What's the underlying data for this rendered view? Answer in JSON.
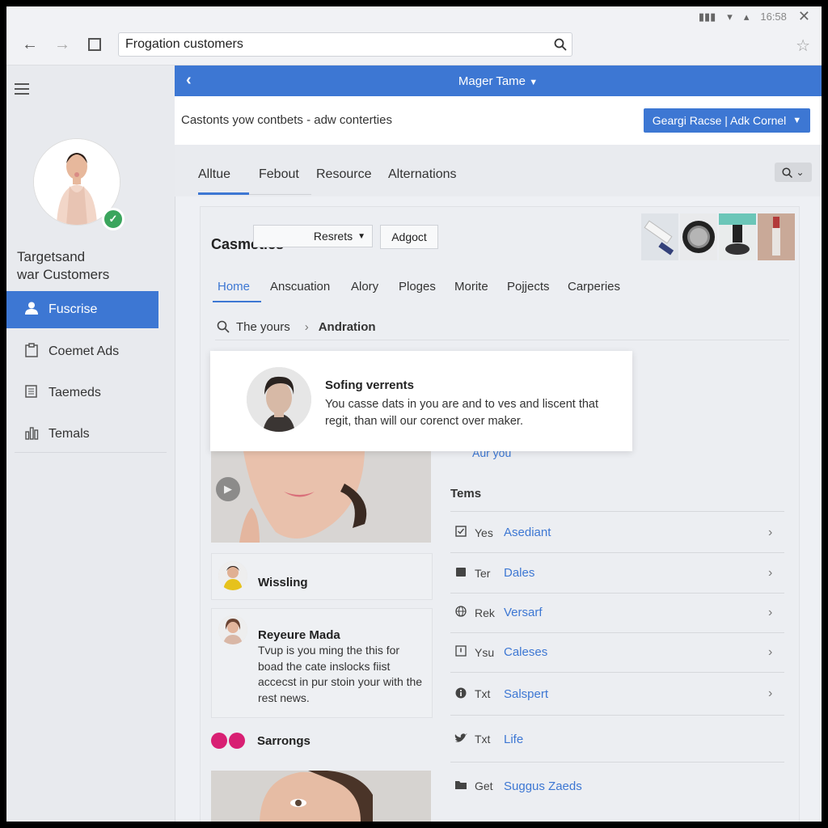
{
  "os": {
    "time": "16:58"
  },
  "browser": {
    "url_text": "Frogation customers"
  },
  "sidebar": {
    "profile_name_line1": "Targetsand",
    "profile_name_line2": "war Customers",
    "items": [
      {
        "label": "Fuscrise",
        "icon": "user-icon",
        "active": true
      },
      {
        "label": "Coemet Ads",
        "icon": "clipboard-icon"
      },
      {
        "label": "Taemeds",
        "icon": "list-icon"
      },
      {
        "label": "Temals",
        "icon": "bar-chart-icon"
      }
    ]
  },
  "app": {
    "title": "Mager Tame",
    "subtitle": "Castonts yow contbets - adw conterties",
    "action_button": "Geargi Racse | Adk Cornel"
  },
  "top_tabs": [
    "Alltue",
    "Febout",
    "Resource",
    "Alternations"
  ],
  "card": {
    "title": "Casmetics",
    "select_value": "Resrets",
    "button": "Adgoct",
    "sub_tabs": [
      "Home",
      "Anscuation",
      "Alory",
      "Ploges",
      "Morite",
      "Pojjects",
      "Carperies"
    ],
    "breadcrumb": {
      "item1": "The yours",
      "item2": "Andration"
    }
  },
  "popup": {
    "title": "Sofing verrents",
    "text": "You casse dats in you are and to ves and liscent that regit, than will our corenct over maker."
  },
  "left_cards": [
    {
      "title": "Wissling"
    },
    {
      "title": "Reyeure Mada",
      "text": "Tvup is you ming the this for boad the cate inslocks fiist accecst in pur stoin your with the rest news."
    },
    {
      "title": "Sarrongs"
    }
  ],
  "right": {
    "link": "Aur you",
    "heading": "Tems",
    "items": [
      {
        "icon": "checkbox-icon",
        "key": "Yes",
        "value": "Asediant"
      },
      {
        "icon": "folder-icon",
        "key": "Ter",
        "value": "Dales"
      },
      {
        "icon": "globe-icon",
        "key": "Rek",
        "value": "Versarf"
      },
      {
        "icon": "alert-icon",
        "key": "Ysu",
        "value": "Caleses"
      },
      {
        "icon": "info-icon",
        "key": "Txt",
        "value": "Salspert"
      },
      {
        "icon": "twitter-icon",
        "key": "Txt",
        "value": "Life"
      },
      {
        "icon": "folder-icon",
        "key": "Get",
        "value": "Suggus Zaeds"
      }
    ]
  },
  "colors": {
    "accent": "#3d77d3",
    "online": "#3ba55d",
    "pink": "#d81f73"
  }
}
